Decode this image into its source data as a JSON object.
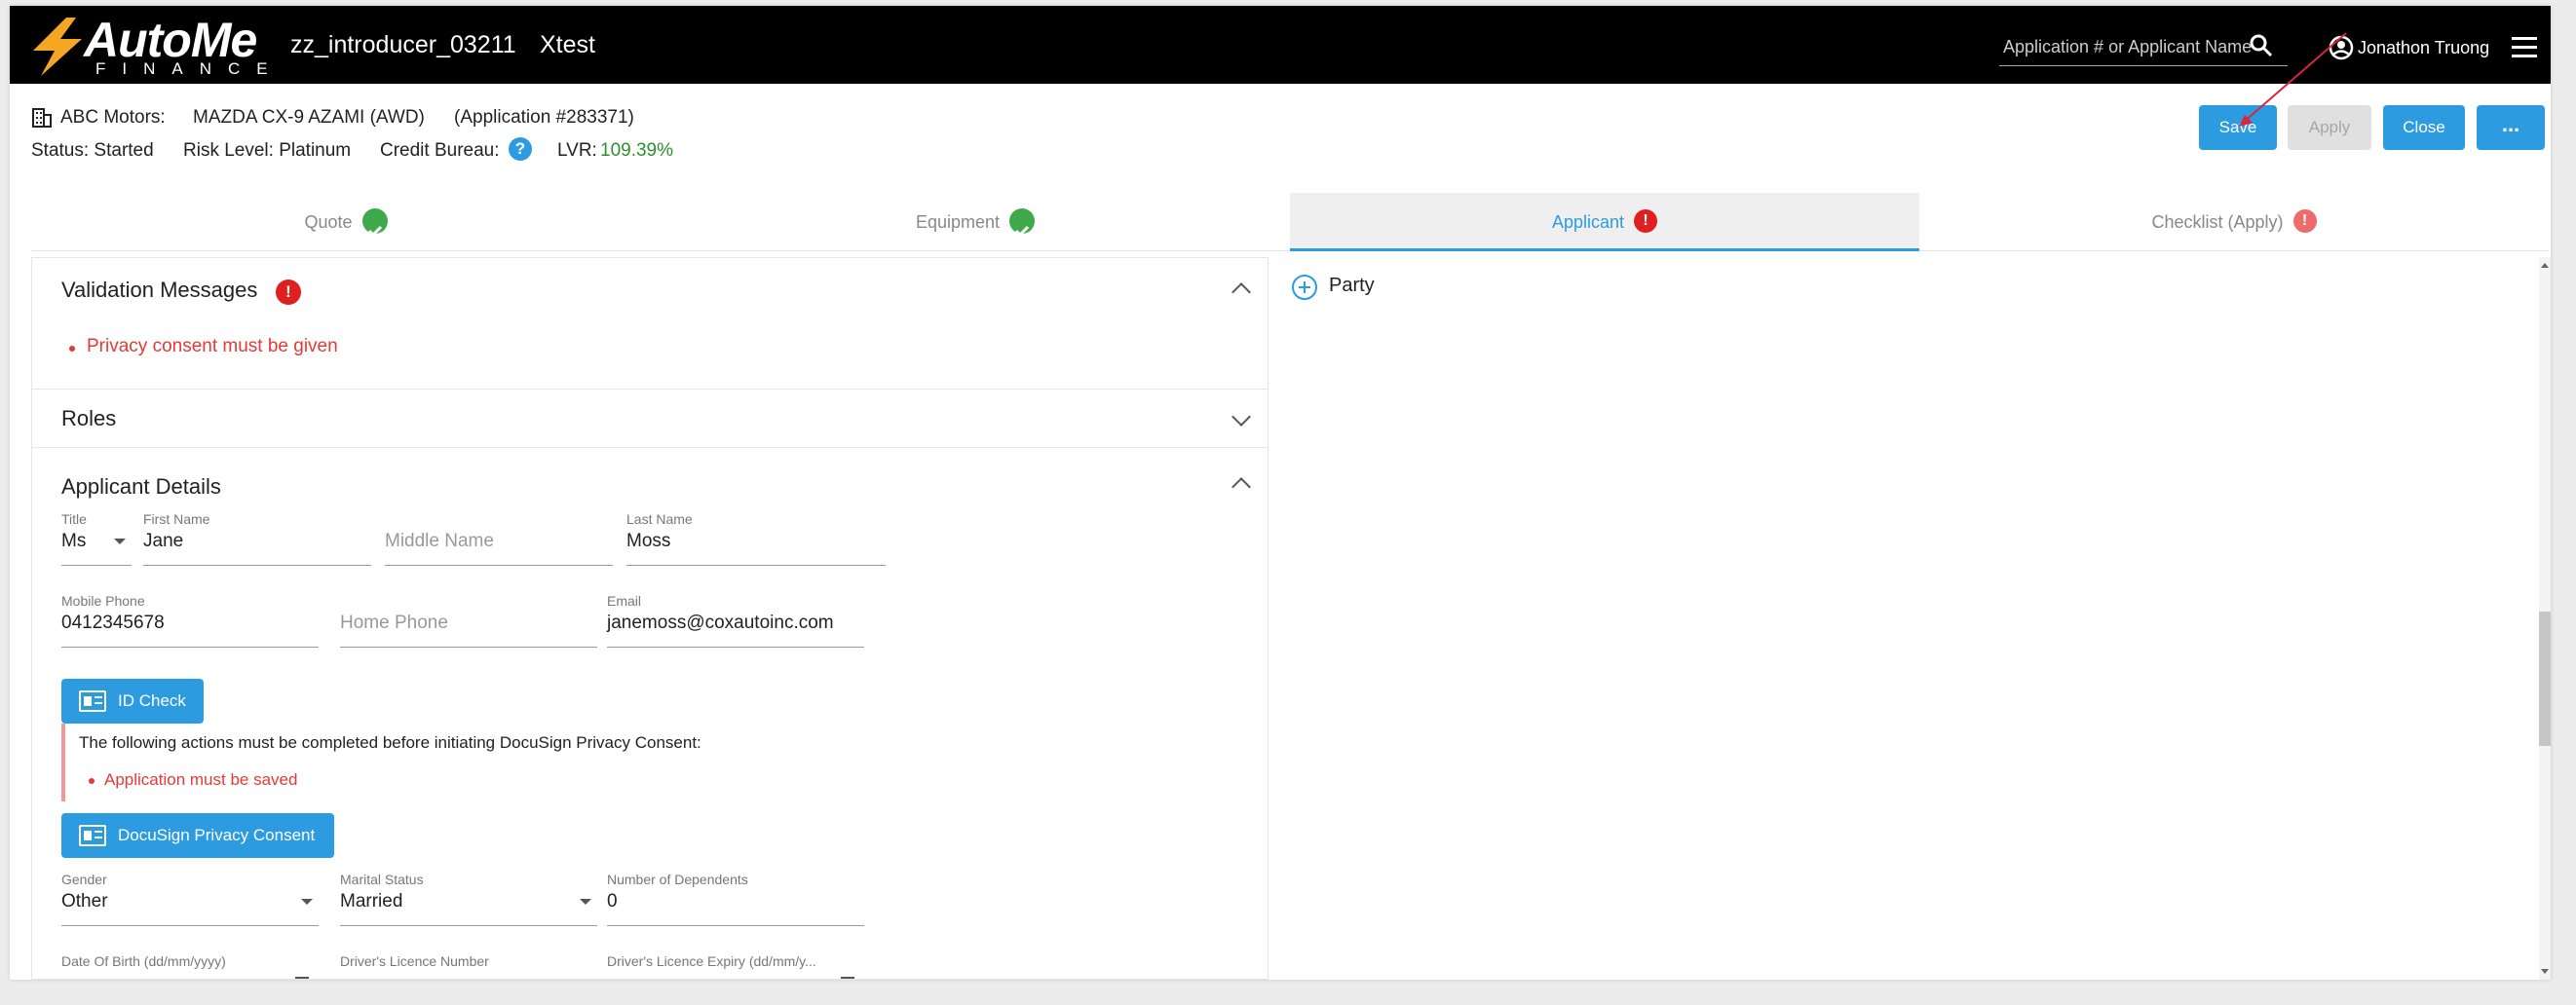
{
  "header": {
    "brand": "AutoMe",
    "brand_sub": "FINANCE",
    "user_id": "zz_introducer_03211",
    "environment": "Xtest",
    "search_placeholder": "Application # or Applicant Name",
    "account_name": "Jonathon Truong"
  },
  "summary": {
    "dealer": "ABC Motors:",
    "vehicle": "MAZDA CX-9 AZAMI (AWD)",
    "application": "(Application #283371)",
    "status": "Status: Started",
    "risk": "Risk Level: Platinum",
    "credit_bureau": "Credit Bureau:",
    "help": "?",
    "lvr_label": "LVR:",
    "lvr_value": "109.39%"
  },
  "actions": {
    "save": "Save",
    "apply": "Apply",
    "close": "Close",
    "more": "..."
  },
  "tabs": [
    {
      "label": "Quote",
      "state": "complete"
    },
    {
      "label": "Equipment",
      "state": "complete"
    },
    {
      "label": "Applicant",
      "state": "error"
    },
    {
      "label": "Checklist (Apply)",
      "state": "error"
    }
  ],
  "validation": {
    "title": "Validation Messages",
    "badge": "!",
    "messages": [
      "Privacy consent must be given"
    ]
  },
  "roles": {
    "title": "Roles"
  },
  "applicant": {
    "title": "Applicant Details",
    "title_field": {
      "label": "Title",
      "value": "Ms"
    },
    "first_name": {
      "label": "First Name",
      "value": "Jane"
    },
    "middle_name": {
      "placeholder": "Middle Name"
    },
    "last_name": {
      "label": "Last Name",
      "value": "Moss"
    },
    "mobile": {
      "label": "Mobile Phone",
      "value": "0412345678"
    },
    "home_phone": {
      "placeholder": "Home Phone"
    },
    "email": {
      "label": "Email",
      "value": "janemoss@coxautoinc.com"
    },
    "id_check_label": "ID Check",
    "notice_text": "The following actions must be completed before initiating DocuSign Privacy Consent:",
    "notice_items": [
      "Application must be saved"
    ],
    "docusign_label": "DocuSign Privacy Consent",
    "gender": {
      "label": "Gender",
      "value": "Other"
    },
    "marital": {
      "label": "Marital Status",
      "value": "Married"
    },
    "dependents": {
      "label": "Number of Dependents",
      "value": "0"
    },
    "dob": {
      "label": "Date Of Birth (dd/mm/yyyy)"
    },
    "licence_no": {
      "label": "Driver's Licence Number"
    },
    "licence_exp": {
      "label": "Driver's Licence Expiry (dd/mm/y..."
    }
  },
  "party": {
    "label": "Party"
  },
  "colors": {
    "primary": "#2d9be0",
    "error": "#e53935",
    "success": "#3faa4c",
    "appbar": "#000000"
  }
}
